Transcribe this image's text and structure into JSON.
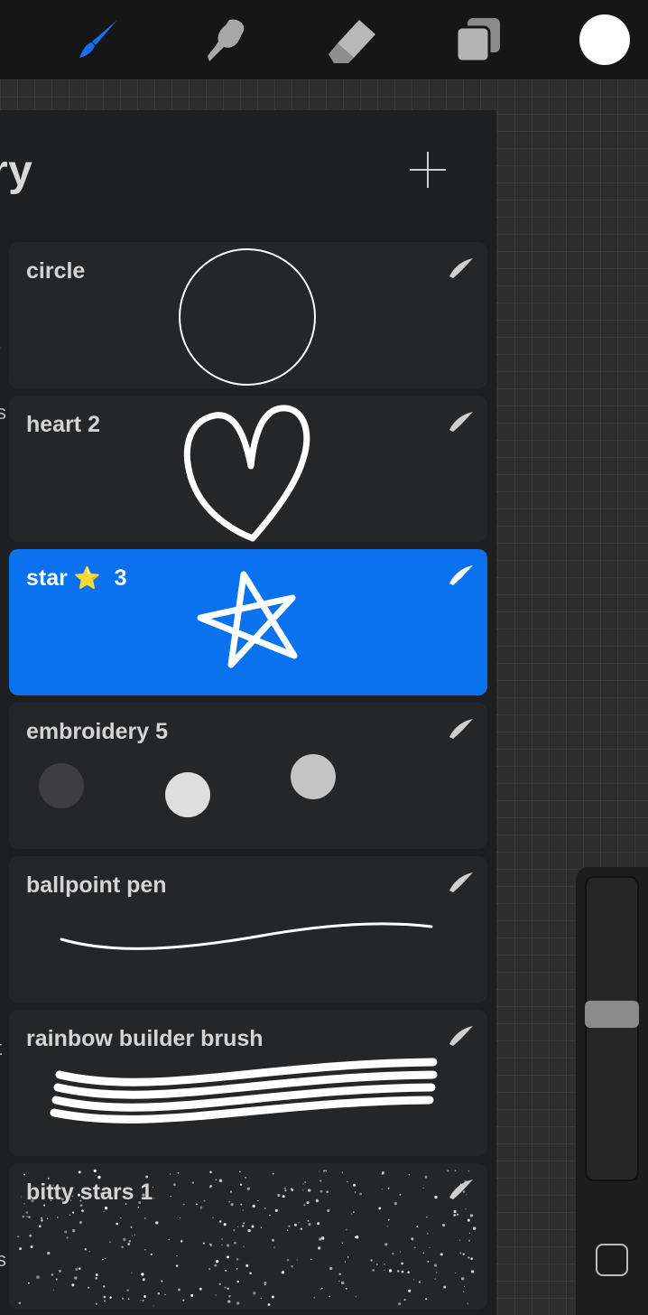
{
  "toolbar": {
    "tools": [
      {
        "name": "paintbrush-icon",
        "active": true
      },
      {
        "name": "smudge-icon",
        "active": false
      },
      {
        "name": "eraser-icon",
        "active": false
      },
      {
        "name": "layers-icon",
        "active": false
      }
    ],
    "active_color": "#ffffff",
    "accent": "#1a6cf0"
  },
  "library": {
    "title_fragment": "ry",
    "add_label": "+"
  },
  "brushes": [
    {
      "label": "circle",
      "emoji": "",
      "suffix": "",
      "selected": false
    },
    {
      "label": "heart 2",
      "emoji": "",
      "suffix": "",
      "selected": false
    },
    {
      "label": "star",
      "emoji": "⭐",
      "suffix": "3",
      "selected": true
    },
    {
      "label": "embroidery 5",
      "emoji": "",
      "suffix": "",
      "selected": false
    },
    {
      "label": "ballpoint pen",
      "emoji": "",
      "suffix": "",
      "selected": false
    },
    {
      "label": "rainbow builder brush",
      "emoji": "",
      "suffix": "",
      "selected": false
    },
    {
      "label": "bitty stars 1",
      "emoji": "",
      "suffix": "",
      "selected": false
    }
  ],
  "side_marks": [
    ".",
    "s",
    "",
    "",
    "",
    "t",
    "s"
  ],
  "selection_color": "#0a72ef"
}
